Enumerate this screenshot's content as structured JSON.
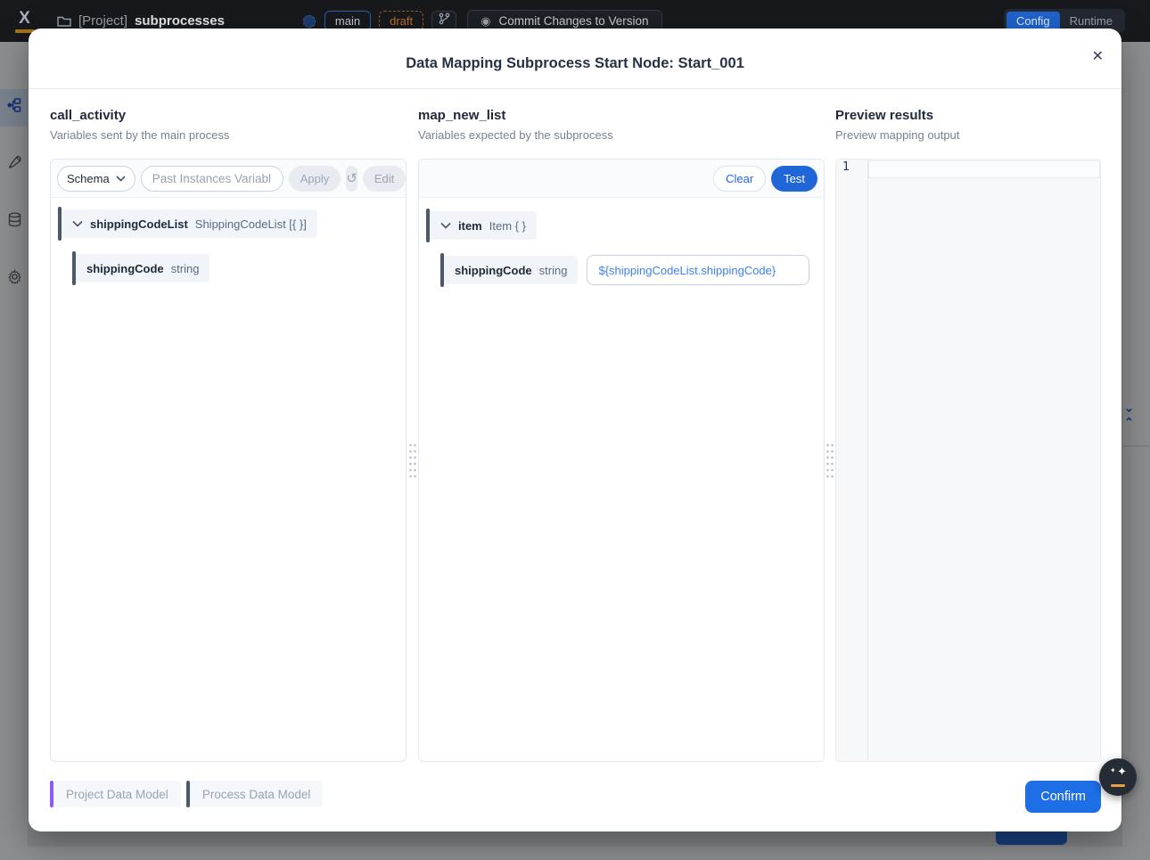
{
  "topbar": {
    "logo": "X",
    "project_label": "[Project]",
    "project_name": "subprocesses",
    "branch_badge": "main",
    "status_badge": "draft",
    "commit_button": "Commit Changes to Version",
    "tabs": {
      "config": "Config",
      "runtime": "Runtime"
    }
  },
  "modal": {
    "title": "Data Mapping Subprocess Start Node: Start_001",
    "source": {
      "title": "call_activity",
      "subtitle": "Variables sent by the main process",
      "toolbar": {
        "schema_label": "Schema",
        "search_placeholder": "Past Instances Variabl...",
        "apply_label": "Apply",
        "edit_label": "Edit"
      },
      "tree": [
        {
          "name": "shippingCodeList",
          "type": "ShippingCodeList [{ }]"
        },
        {
          "name": "shippingCode",
          "type": "string"
        }
      ]
    },
    "target": {
      "title": "map_new_list",
      "subtitle": "Variables expected by the subprocess",
      "toolbar": {
        "clear_label": "Clear",
        "test_label": "Test"
      },
      "tree": [
        {
          "name": "item",
          "type": "Item { }"
        },
        {
          "name": "shippingCode",
          "type": "string",
          "mapping": "${shippingCodeList.shippingCode}"
        }
      ]
    },
    "preview": {
      "title": "Preview results",
      "subtitle": "Preview mapping output",
      "line_number": "1"
    },
    "footer": {
      "project_data_model": "Project Data Model",
      "process_data_model": "Process Data Model",
      "confirm_label": "Confirm"
    }
  },
  "icons": {
    "close": "✕",
    "history": "↺",
    "commit": "◉",
    "sparkle": "✦",
    "chevrons_right_panel": "⌄ ⌃"
  },
  "colors": {
    "primary_blue": "#2166d9",
    "confirm_blue": "#1e6ee6",
    "draft_orange": "#c0701f",
    "branch_border_blue": "#2e5da8",
    "accent_slate": "#4b5a6b",
    "accent_purple": "#8b5cf6",
    "logo_amber": "#a8770a",
    "fab_amber": "#e6a23c",
    "mapping_text_blue": "#3c82f6"
  }
}
